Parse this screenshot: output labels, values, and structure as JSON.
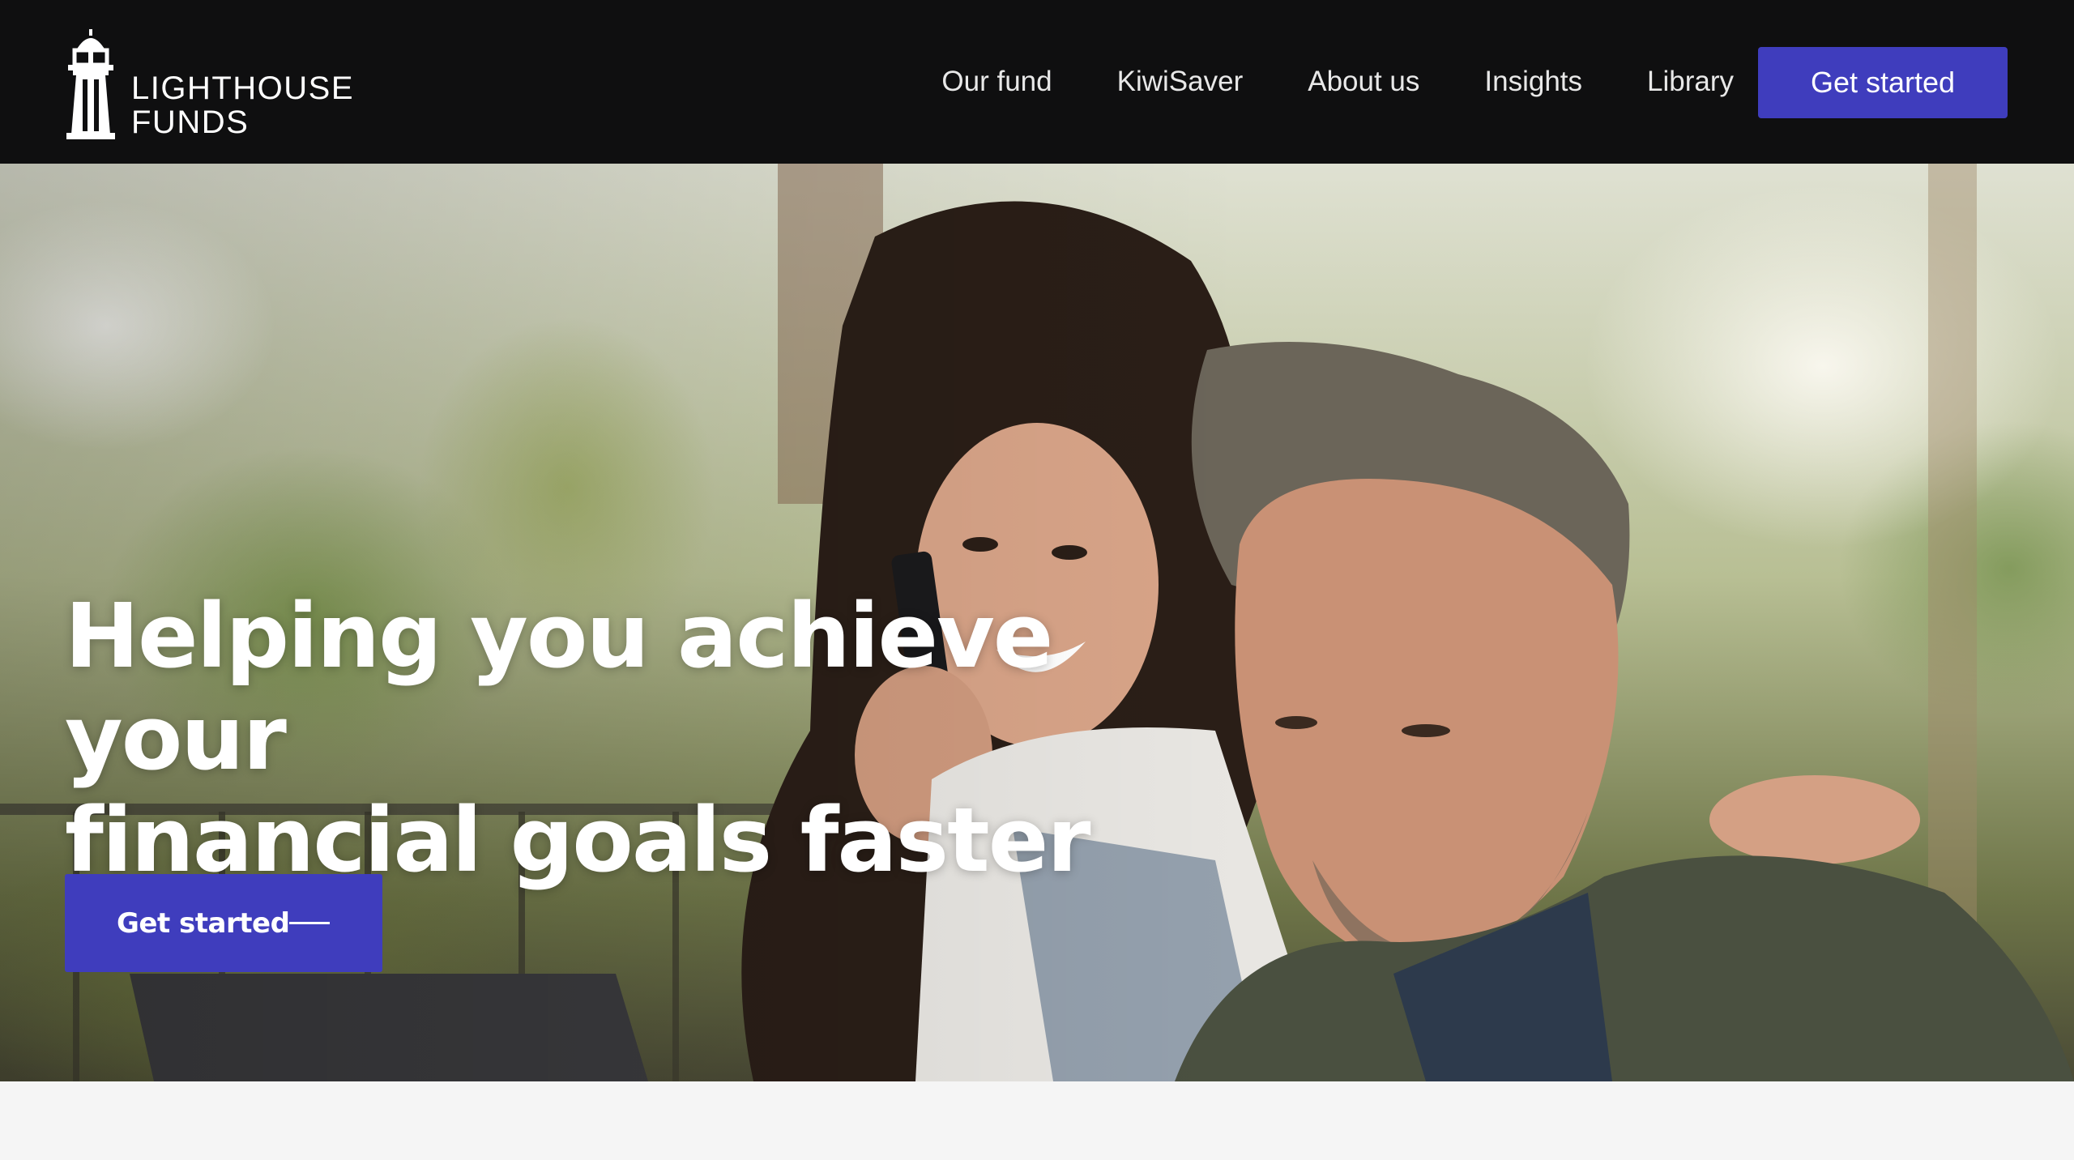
{
  "brand": {
    "line1": "LIGHTHOUSE",
    "line2": "FUNDS",
    "logo_icon": "lighthouse-icon"
  },
  "nav": {
    "items": [
      {
        "label": "Our fund"
      },
      {
        "label": "KiwiSaver"
      },
      {
        "label": "About us"
      },
      {
        "label": "Insights"
      },
      {
        "label": "Library"
      }
    ],
    "cta_label": "Get started"
  },
  "hero": {
    "title_line1": "Helping you achieve your",
    "title_line2": "financial goals faster",
    "cta_label": "Get started",
    "cta_icon": "arrow-line-icon",
    "image": "couple-smiling-phone-laptop-photo"
  },
  "colors": {
    "header_bg": "#0f0f10",
    "accent": "#3f3dbd",
    "text_on_dark": "#ffffff",
    "page_bg": "#f5f5f5"
  }
}
